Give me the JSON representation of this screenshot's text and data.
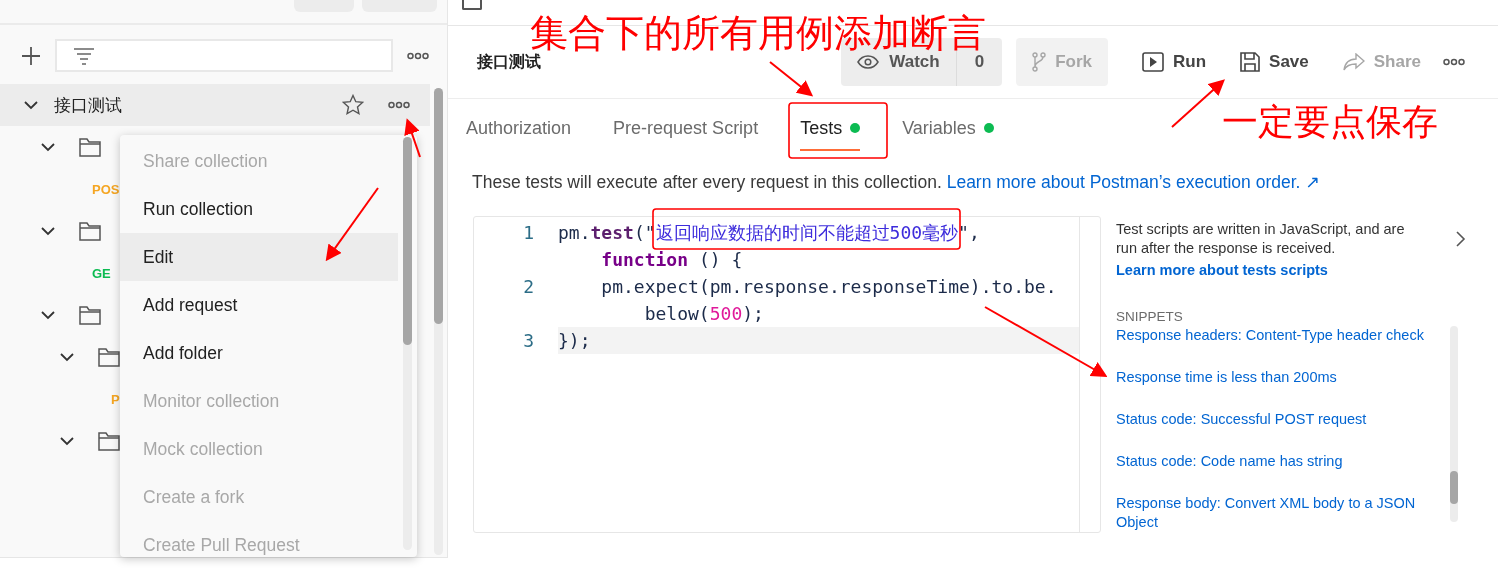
{
  "sidebar": {
    "collection": {
      "name": "接口测试",
      "expanded": true,
      "starred": false
    },
    "tree": [
      {
        "kind": "folder",
        "expanded": true,
        "children": [
          {
            "kind": "request",
            "method": "POS",
            "color": "#f5a623"
          }
        ]
      },
      {
        "kind": "folder",
        "expanded": true,
        "children": [
          {
            "kind": "request",
            "method": "GE",
            "color": "#0cbb52"
          }
        ]
      },
      {
        "kind": "folder",
        "expanded": true,
        "children": [
          {
            "kind": "folder",
            "expanded": true,
            "children": [
              {
                "kind": "request",
                "method": "P",
                "color": "#f5a623"
              }
            ]
          },
          {
            "kind": "folder",
            "expanded": true
          }
        ]
      }
    ]
  },
  "context_menu": [
    {
      "label": "Share collection",
      "disabled": true,
      "selected": false
    },
    {
      "label": "Run collection",
      "disabled": false,
      "selected": false
    },
    {
      "label": "Edit",
      "disabled": false,
      "selected": true
    },
    {
      "label": "Add request",
      "disabled": false,
      "selected": false
    },
    {
      "label": "Add folder",
      "disabled": false,
      "selected": false
    },
    {
      "label": "Monitor collection",
      "disabled": true,
      "selected": false
    },
    {
      "label": "Mock collection",
      "disabled": true,
      "selected": false
    },
    {
      "label": "Create a fork",
      "disabled": true,
      "selected": false
    },
    {
      "label": "Create Pull Request",
      "disabled": true,
      "selected": false
    }
  ],
  "header": {
    "title": "接口测试",
    "watch": {
      "label": "Watch",
      "count": "0"
    },
    "actions": [
      {
        "kind": "fork",
        "label": "Fork",
        "disabled": true
      },
      {
        "kind": "run",
        "label": "Run",
        "disabled": false
      },
      {
        "kind": "save",
        "label": "Save",
        "disabled": false
      },
      {
        "kind": "share",
        "label": "Share",
        "disabled": true
      }
    ]
  },
  "tabs": [
    {
      "label": "Authorization",
      "selected": false,
      "dot": false
    },
    {
      "label": "Pre-request Script",
      "selected": false,
      "dot": false
    },
    {
      "label": "Tests",
      "selected": true,
      "dot": true
    },
    {
      "label": "Variables",
      "selected": false,
      "dot": true
    }
  ],
  "description": {
    "text": "These tests will execute after every request in this collection.",
    "link": "Learn more about Postman’s execution order. ↗"
  },
  "editor": {
    "lines": [
      {
        "number": "1",
        "active": false,
        "rows": [
          {
            "tokens": [
              {
                "t": "pm.",
                "kind": "plain"
              },
              {
                "t": "test",
                "kind": "keyword"
              },
              {
                "t": "(\"",
                "kind": "plain"
              },
              {
                "t": "返回响应数据的时间不能超过500毫秒",
                "kind": "string"
              },
              {
                "t": "\",",
                "kind": "plain"
              }
            ]
          },
          {
            "tokens": [
              {
                "t": "function",
                "kind": "keyword2"
              },
              {
                "t": " () {",
                "kind": "plain"
              }
            ]
          }
        ]
      },
      {
        "number": "2",
        "active": false,
        "rows": [
          {
            "tokens": [
              {
                "t": "    pm.expect(pm.response.responseTime).to.be.",
                "kind": "plain"
              }
            ]
          },
          {
            "tokens": [
              {
                "t": "below(",
                "kind": "plain"
              },
              {
                "t": "500",
                "kind": "number"
              },
              {
                "t": ");",
                "kind": "plain"
              }
            ]
          }
        ]
      },
      {
        "number": "3",
        "active": true,
        "rows": [
          {
            "tokens": [
              {
                "t": "});",
                "kind": "plain"
              }
            ]
          }
        ]
      }
    ]
  },
  "help": {
    "text": "Test scripts are written in JavaScript, and are run after the response is received.",
    "link": "Learn more about tests scripts",
    "snippets_title": "SNIPPETS",
    "snippets": [
      "Response headers: Content-Type header check",
      "Response time is less than 200ms",
      "Status code: Successful POST request",
      "Status code: Code name has string",
      "Response body: Convert XML body to a JSON Object"
    ]
  },
  "annotations": [
    {
      "text": "集合下的所有用例添加断言"
    },
    {
      "text": "一定要点保存"
    }
  ]
}
